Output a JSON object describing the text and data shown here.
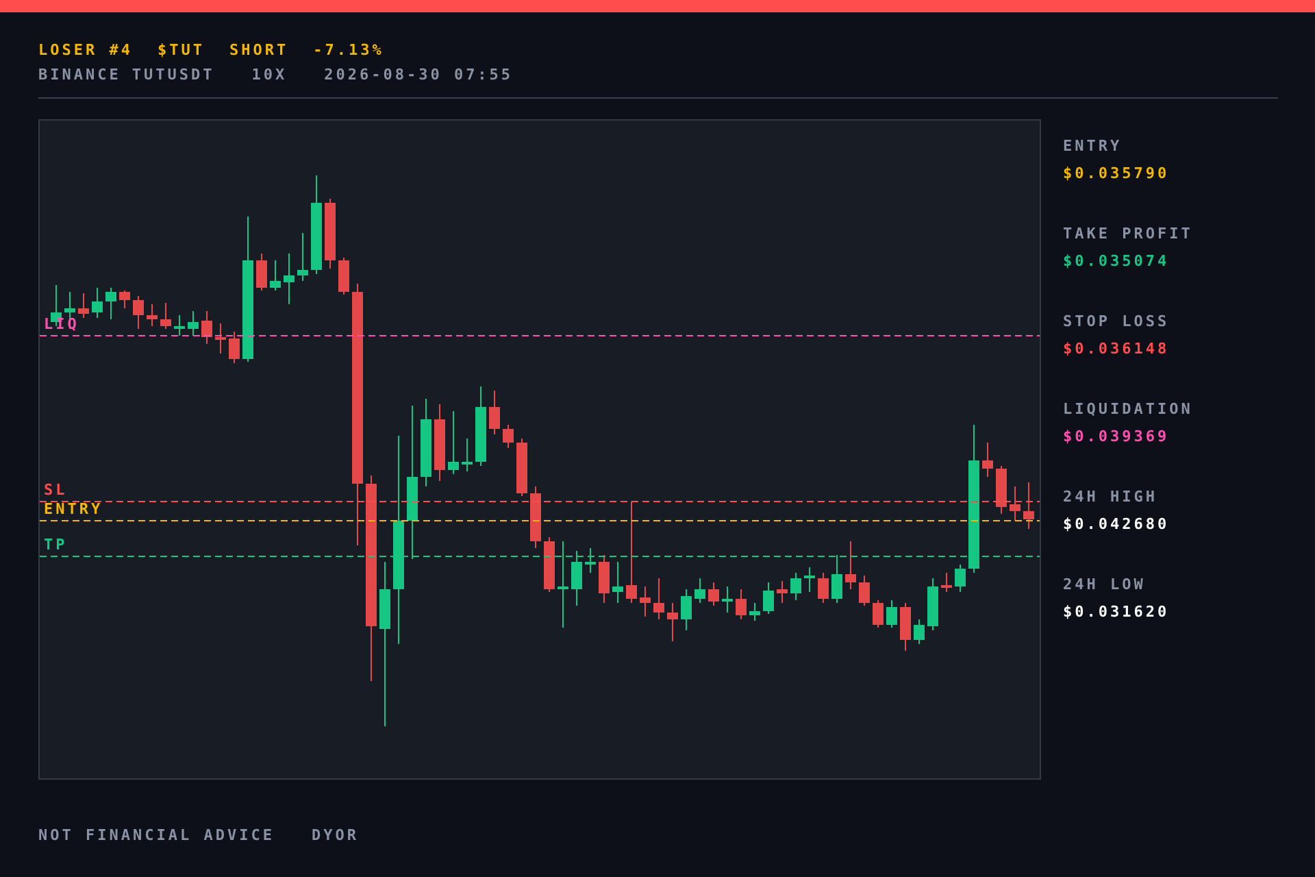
{
  "header": {
    "rank": "LOSER #4",
    "ticker": "$TUT",
    "side": "SHORT",
    "change": "-7.13%",
    "exchange": "BINANCE",
    "pair": "TUTUSDT",
    "leverage": "10X",
    "timestamp": "2026-08-30 07:55"
  },
  "chart": {
    "levels": [
      {
        "kind": "liq",
        "label": "LIQ",
        "color": "#ff4fb0"
      },
      {
        "kind": "sl",
        "label": "SL",
        "color": "#ff4d4d"
      },
      {
        "kind": "entry",
        "label": "ENTRY",
        "color": "#f5b800"
      },
      {
        "kind": "tp",
        "label": "TP",
        "color": "#16c784"
      }
    ]
  },
  "stats": [
    {
      "label": "ENTRY",
      "value": "$0.035790",
      "color": "#f5b800"
    },
    {
      "label": "TAKE PROFIT",
      "value": "$0.035074",
      "color": "#16c784"
    },
    {
      "label": "STOP LOSS",
      "value": "$0.036148",
      "color": "#ff4d4d"
    },
    {
      "label": "LIQUIDATION",
      "value": "$0.039369",
      "color": "#ff4fb0"
    },
    {
      "label": "24H HIGH",
      "value": "$0.042680",
      "color": "#ffffff"
    },
    {
      "label": "24H LOW",
      "value": "$0.031620",
      "color": "#ffffff"
    }
  ],
  "footer": {
    "disclaimer": "NOT FINANCIAL ADVICE",
    "note": "DYOR"
  }
}
